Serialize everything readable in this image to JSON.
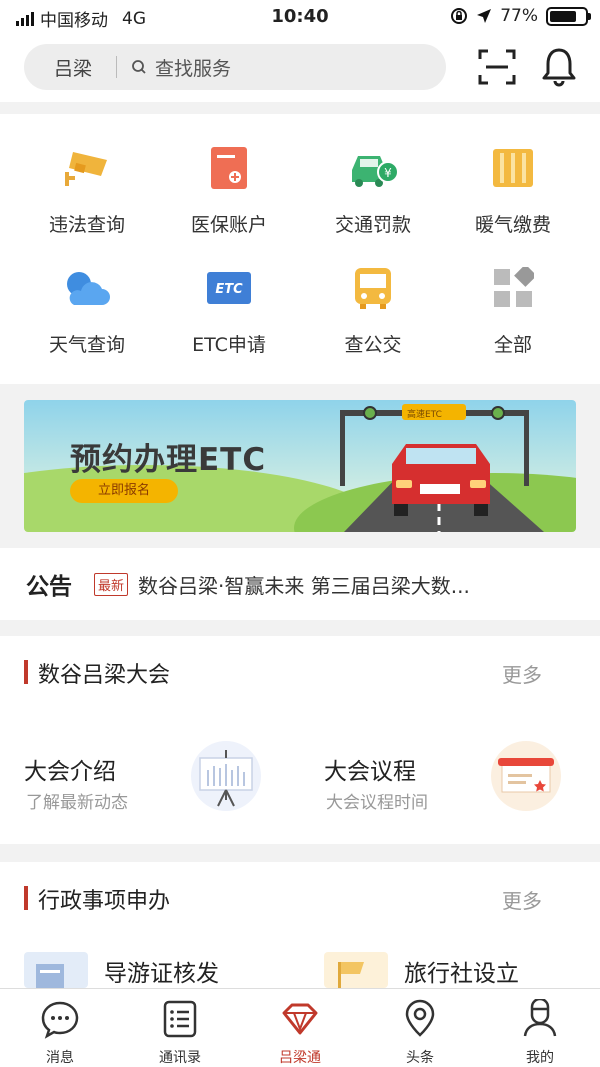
{
  "status_bar": {
    "carrier": "中国移动",
    "network": "4G",
    "time": "10:40",
    "battery": "77%",
    "battery_level": 0.77
  },
  "header": {
    "city": "吕梁",
    "search_placeholder": "查找服务"
  },
  "services": [
    {
      "label": "违法查询",
      "icon": "camera-icon"
    },
    {
      "label": "医保账户",
      "icon": "medical-card-icon"
    },
    {
      "label": "交通罚款",
      "icon": "car-fine-icon"
    },
    {
      "label": "暖气缴费",
      "icon": "radiator-icon"
    },
    {
      "label": "天气查询",
      "icon": "weather-icon"
    },
    {
      "label": "ETC申请",
      "icon": "etc-card-icon",
      "icon_text": "ETC"
    },
    {
      "label": "查公交",
      "icon": "bus-icon"
    },
    {
      "label": "全部",
      "icon": "all-grid-icon"
    }
  ],
  "banner": {
    "title": "预约办理ETC",
    "cta": "立即报名",
    "gate_label": "高速ETC"
  },
  "notice": {
    "title": "公告",
    "badge": "最新",
    "text": "数谷吕梁·智赢未来 第三届吕梁大数..."
  },
  "conference": {
    "title": "数谷吕梁大会",
    "more": "更多",
    "cards": [
      {
        "title": "大会介绍",
        "subtitle": "了解最新动态"
      },
      {
        "title": "大会议程",
        "subtitle": "大会议程时间"
      }
    ]
  },
  "admin": {
    "title": "行政事项申办",
    "more": "更多",
    "cards": [
      {
        "title": "导游证核发"
      },
      {
        "title": "旅行社设立"
      }
    ]
  },
  "tabs": [
    {
      "label": "消息",
      "icon": "message-icon"
    },
    {
      "label": "通讯录",
      "icon": "contacts-icon"
    },
    {
      "label": "吕梁通",
      "icon": "diamond-icon",
      "active": true
    },
    {
      "label": "头条",
      "icon": "headline-icon"
    },
    {
      "label": "我的",
      "icon": "profile-icon"
    }
  ],
  "colors": {
    "accent": "#c0392b",
    "orange": "#f4b400",
    "blue": "#4a90e2",
    "green": "#3cb371"
  }
}
